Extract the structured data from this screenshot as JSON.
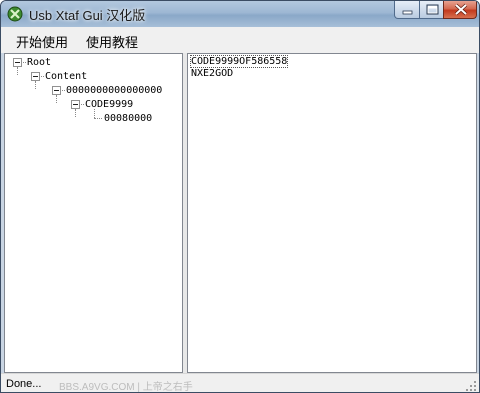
{
  "window": {
    "title": "Usb Xtaf Gui 汉化版",
    "icon": "app-icon",
    "controls": [
      "minimize-icon",
      "maximize-icon",
      "close-icon"
    ]
  },
  "menu": {
    "items": [
      {
        "label": "开始使用"
      },
      {
        "label": "使用教程"
      }
    ]
  },
  "tree": {
    "nodes": [
      {
        "label": "Root",
        "expanded": true,
        "depth": 0
      },
      {
        "label": "Content",
        "expanded": true,
        "depth": 1
      },
      {
        "label": "0000000000000000",
        "expanded": true,
        "depth": 2
      },
      {
        "label": "CODE9999",
        "expanded": true,
        "depth": 3
      },
      {
        "label": "00080000",
        "expanded": false,
        "depth": 4
      }
    ]
  },
  "content": {
    "lines": [
      "CODE9999OF586558",
      "NXE2GOD"
    ]
  },
  "status": {
    "text": "Done...",
    "watermark": "BBS.A9VG.COM | 上帝之右手"
  }
}
